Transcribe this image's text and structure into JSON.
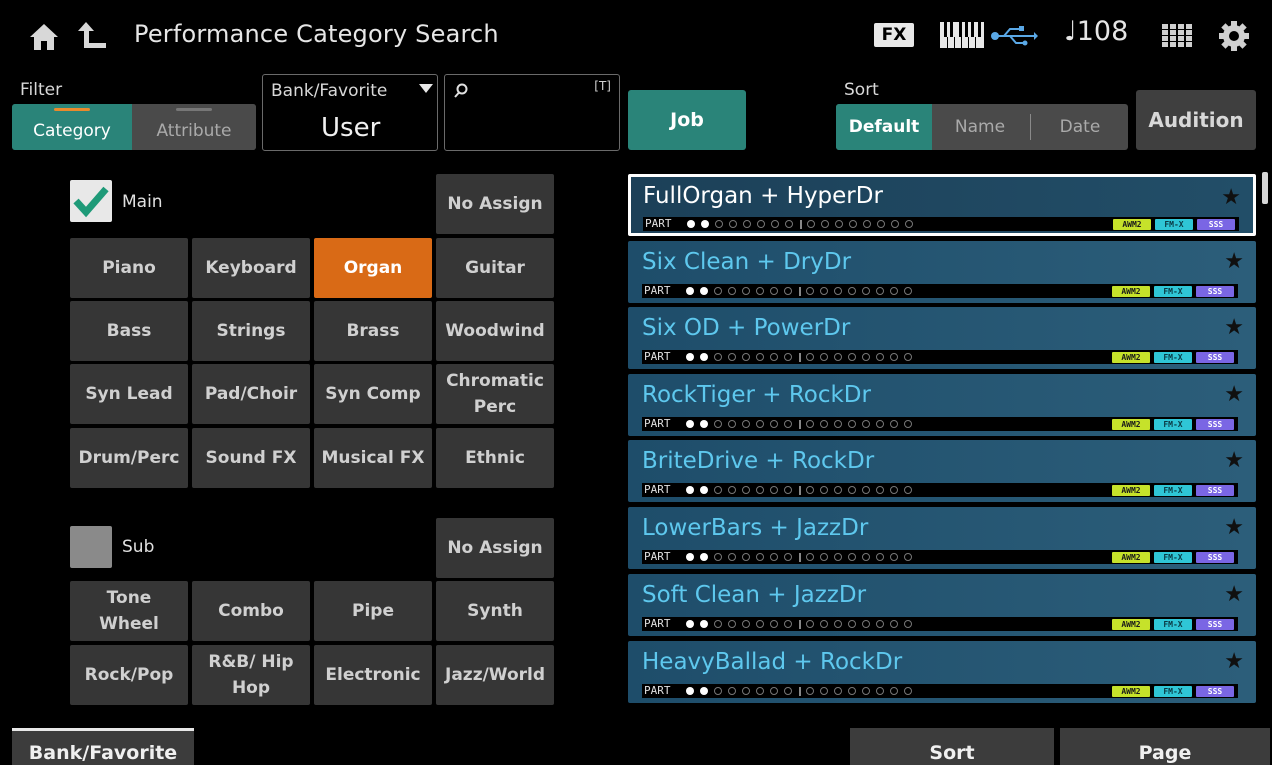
{
  "header": {
    "title": "Performance Category Search",
    "fx_label": "FX",
    "tempo": "♩108",
    "icons": [
      "home-icon",
      "back-up-icon",
      "keyboard-icon",
      "usb-icon",
      "grid-icon",
      "gear-icon"
    ]
  },
  "filter": {
    "label": "Filter",
    "tabs": [
      "Category",
      "Attribute"
    ],
    "selected": "Category"
  },
  "bank": {
    "label": "Bank/Favorite",
    "value": "User"
  },
  "search": {
    "value": "",
    "text_marker": "[T]"
  },
  "job_label": "Job",
  "sort": {
    "label": "Sort",
    "options": [
      "Default",
      "Name",
      "Date"
    ],
    "selected": "Default"
  },
  "audition_label": "Audition",
  "main": {
    "label": "Main",
    "checked": true,
    "no_assign": "No Assign",
    "categories": [
      "Piano",
      "Keyboard",
      "Organ",
      "Guitar",
      "Bass",
      "Strings",
      "Brass",
      "Woodwind",
      "Syn Lead",
      "Pad/Choir",
      "Syn Comp",
      "Chromatic Perc",
      "Drum/Perc",
      "Sound FX",
      "Musical FX",
      "Ethnic"
    ],
    "selected": "Organ"
  },
  "sub": {
    "label": "Sub",
    "checked": false,
    "no_assign": "No Assign",
    "categories": [
      "Tone Wheel",
      "Combo",
      "Pipe",
      "Synth",
      "Rock/Pop",
      "R&B/ Hip Hop",
      "Electronic",
      "Jazz/World"
    ]
  },
  "performances": [
    {
      "name": "FullOrgan + HyperDr",
      "selected": true
    },
    {
      "name": "Six Clean + DryDr",
      "selected": false
    },
    {
      "name": "Six OD + PowerDr",
      "selected": false
    },
    {
      "name": "RockTiger + RockDr",
      "selected": false
    },
    {
      "name": "BriteDrive + RockDr",
      "selected": false
    },
    {
      "name": "LowerBars + JazzDr",
      "selected": false
    },
    {
      "name": "Soft Clean + JazzDr",
      "selected": false
    },
    {
      "name": "HeavyBallad + RockDr",
      "selected": false
    }
  ],
  "row_common": {
    "part_label": "PART",
    "parts_filled": 2,
    "parts_total": 16,
    "badges": [
      "AWM2",
      "FM-X",
      "SSS"
    ],
    "star": "★"
  },
  "bottom": {
    "bank_tab": "Bank/Favorite",
    "sort_tab": "Sort",
    "page_tab": "Page"
  },
  "colors": {
    "teal_active": "#2a8479",
    "orange_selected": "#d96a16",
    "row_blue": "#1e4d6a",
    "name_cyan": "#5ec8ee"
  }
}
